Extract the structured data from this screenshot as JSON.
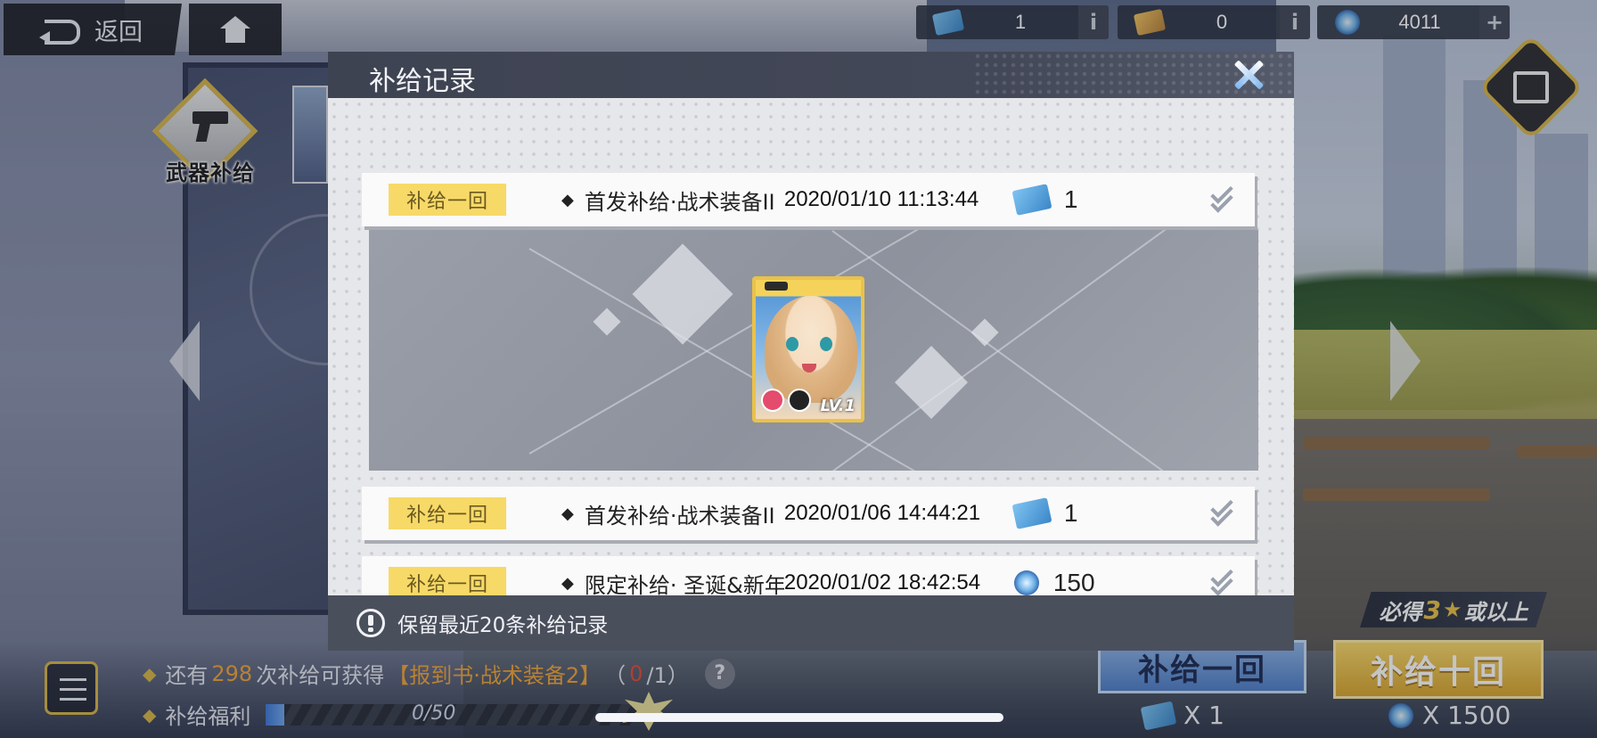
{
  "topbar": {
    "back_label": "返回",
    "resources": [
      {
        "icon": "blue-ticket-icon",
        "value": "1",
        "button": "i"
      },
      {
        "icon": "gold-ticket-icon",
        "value": "0",
        "button": "i"
      },
      {
        "icon": "crystal-icon",
        "value": "4011",
        "button": "+"
      }
    ]
  },
  "category": {
    "label": "武器补给"
  },
  "modal": {
    "title": "补给记录",
    "records": [
      {
        "tag": "补给一回",
        "name": "首发补给·战术装备II",
        "time": "2020/01/10 11:13:44",
        "cost_icon": "blue-ticket-icon",
        "count": "1"
      },
      {
        "tag": "补给一回",
        "name": "首发补给·战术装备II",
        "time": "2020/01/06 14:44:21",
        "cost_icon": "blue-ticket-icon",
        "count": "1"
      },
      {
        "tag": "补给一回",
        "name": "限定补给· 圣诞&新年",
        "time": "2020/01/02 18:42:54",
        "cost_icon": "crystal-icon",
        "count": "150"
      }
    ],
    "reveal": {
      "card_level": "LV.1"
    },
    "footer_note": "保留最近20条补给记录"
  },
  "hud": {
    "line1_prefix": "还有",
    "line1_count": "298",
    "line1_mid": "次补给可获得",
    "line1_item": "【报到书·战术装备2】",
    "line1_progress_open": "（",
    "line1_progress_done": "0",
    "line1_progress_close": "/1）",
    "help": "?",
    "line2_label": "补给福利",
    "progress_text": "0/50",
    "progress_fraction": 0.05
  },
  "draw": {
    "guarantee_prefix": "必得",
    "guarantee_num": "3",
    "guarantee_star": "★",
    "guarantee_suffix": "或以上",
    "draw_one_label": "补给一回",
    "draw_ten_label": "补给十回",
    "cost_one": "X 1",
    "cost_ten": "X 1500"
  },
  "colors": {
    "accent_gold": "#d7b64a",
    "tag_yellow": "#f7d968",
    "highlight_orange": "#f0a43a"
  }
}
